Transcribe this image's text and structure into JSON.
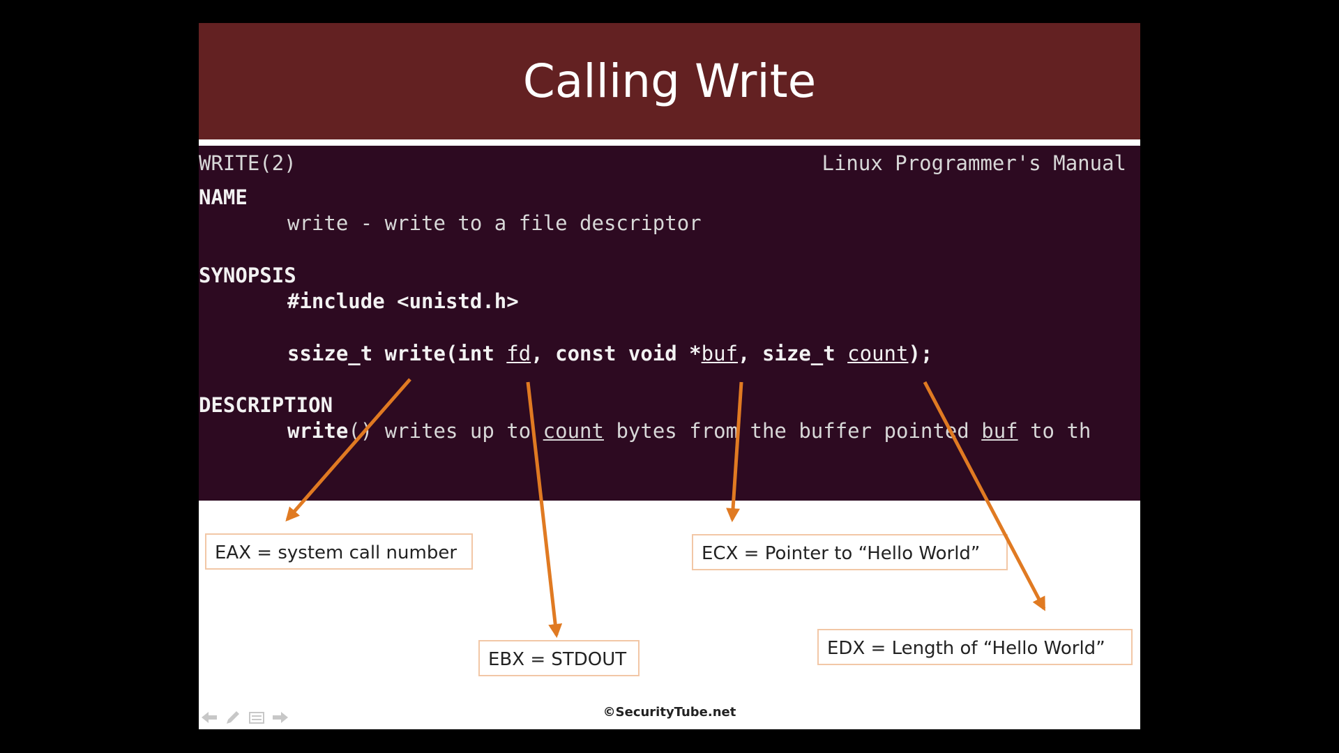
{
  "slide": {
    "title": "Calling Write",
    "copyright": "©SecurityTube.net"
  },
  "manpage": {
    "header_left": "WRITE(2)",
    "header_right": "Linux Programmer's Manual",
    "name_heading": "NAME",
    "name_text": "write - write to a file descriptor",
    "synopsis_heading": "SYNOPSIS",
    "include": "#include <unistd.h>",
    "signature": {
      "p1": "ssize_t write(int ",
      "fd": "fd",
      "p2": ", const void *",
      "buf": "buf",
      "p3": ", size_t ",
      "count": "count",
      "p4": ");"
    },
    "description_heading": "DESCRIPTION",
    "description": {
      "p1": "write",
      "p2": "() writes up to ",
      "count": "count",
      "p3": " bytes from the buffer pointed ",
      "buf": "buf",
      "p4": " to th"
    }
  },
  "registers": {
    "eax": "EAX = system call number",
    "ebx": "EBX = STDOUT",
    "ecx": "ECX = Pointer to “Hello World”",
    "edx": "EDX = Length of “Hello World”"
  },
  "colors": {
    "title_bar": "#632122",
    "terminal_bg": "#2d0a21",
    "arrow": "#e07a22",
    "box_border": "#f2c7a6"
  },
  "icons": [
    "back-arrow-icon",
    "pen-icon",
    "menu-icon",
    "forward-arrow-icon"
  ]
}
